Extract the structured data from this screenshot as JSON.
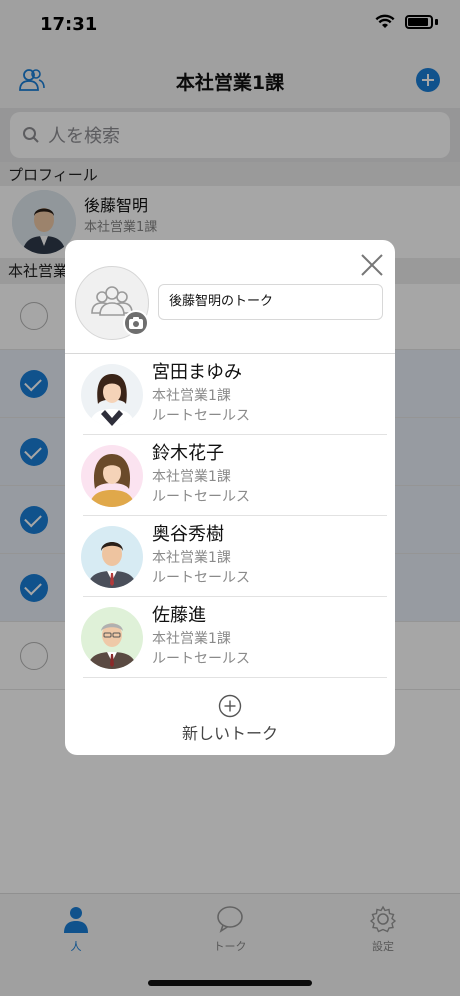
{
  "status_bar": {
    "time": "17:31"
  },
  "nav": {
    "title": "本社営業1課"
  },
  "search": {
    "placeholder": "人を検索"
  },
  "sections": {
    "profile": "プロフィール",
    "department": "本社営業"
  },
  "profile": {
    "name": "後藤智明",
    "department": "本社営業1課"
  },
  "background_list": {
    "rows": [
      {
        "checked": false
      },
      {
        "checked": true
      },
      {
        "checked": true
      },
      {
        "checked": true
      },
      {
        "checked": true
      },
      {
        "checked": false
      }
    ]
  },
  "modal": {
    "talk_title": "後藤智明のトーク",
    "members": [
      {
        "name": "宮田まゆみ",
        "department": "本社営業1課",
        "team": "ルートセールス"
      },
      {
        "name": "鈴木花子",
        "department": "本社営業1課",
        "team": "ルートセールス"
      },
      {
        "name": "奥谷秀樹",
        "department": "本社営業1課",
        "team": "ルートセールス"
      },
      {
        "name": "佐藤進",
        "department": "本社営業1課",
        "team": "ルートセールス"
      }
    ],
    "new_talk_label": "新しいトーク"
  },
  "tabs": [
    {
      "label": "人",
      "icon": "person-icon",
      "active": true
    },
    {
      "label": "トーク",
      "icon": "chat-bubble-icon",
      "active": false
    },
    {
      "label": "設定",
      "icon": "gear-icon",
      "active": false
    }
  ],
  "colors": {
    "accent": "#1a7fd8",
    "overlay": "rgba(0,0,0,0.35)"
  }
}
